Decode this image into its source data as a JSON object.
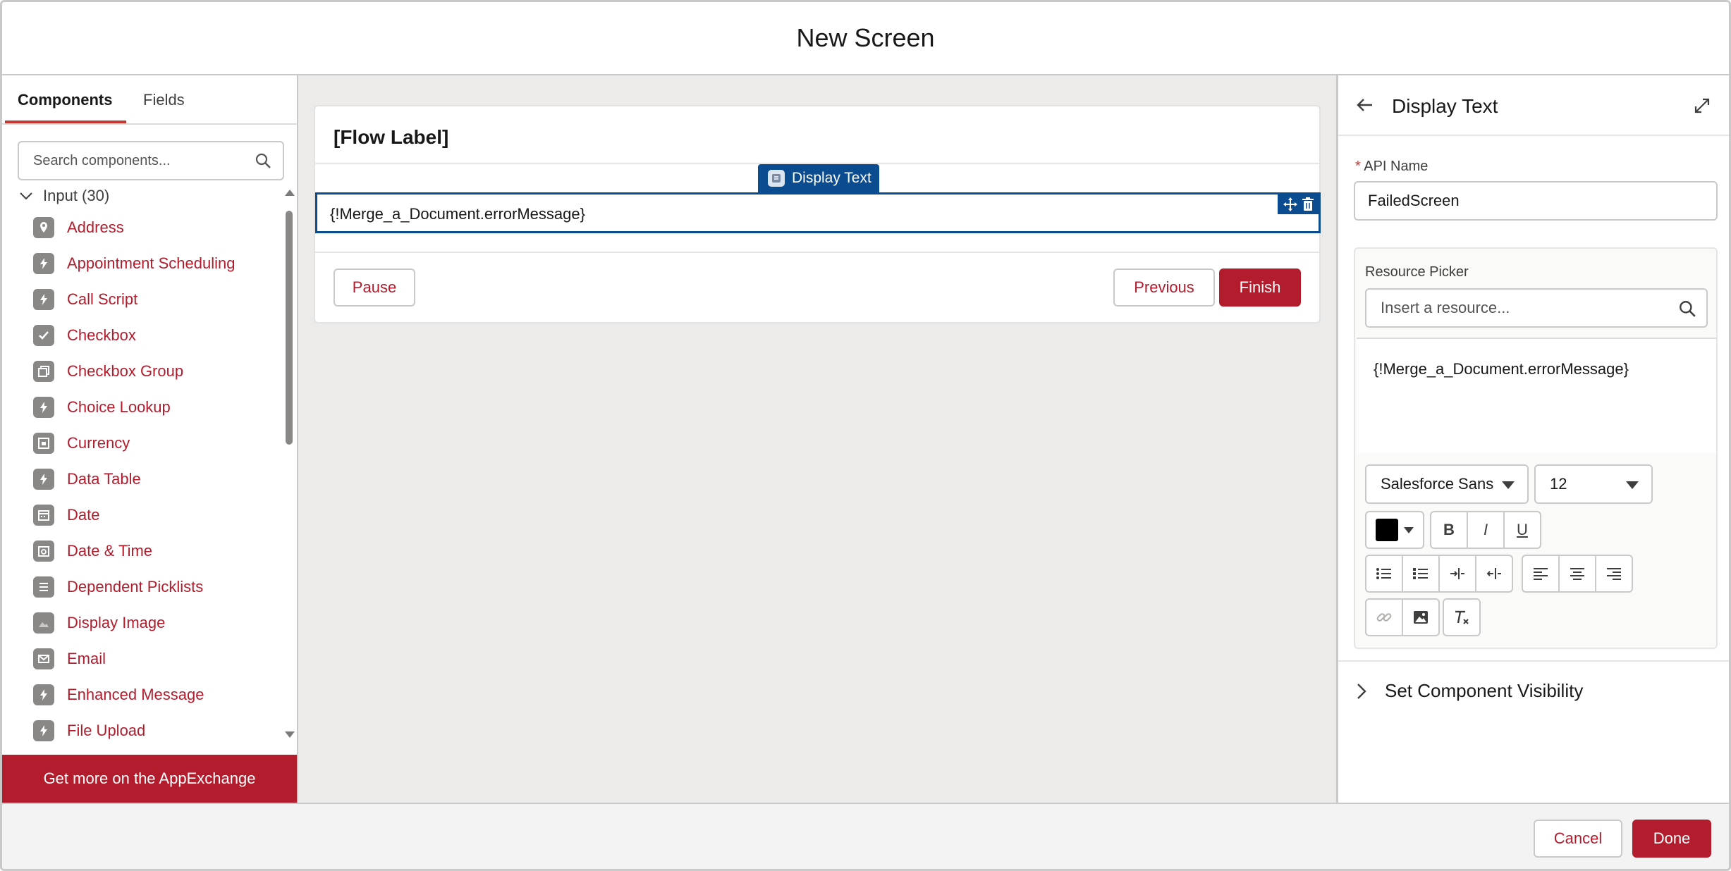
{
  "header": {
    "title": "New Screen"
  },
  "left_panel": {
    "tabs": [
      {
        "label": "Components",
        "active": true
      },
      {
        "label": "Fields",
        "active": false
      }
    ],
    "search": {
      "placeholder": "Search components..."
    },
    "section": {
      "label": "Input (30)",
      "expanded": true
    },
    "components": [
      {
        "label": "Address",
        "icon": "location-pin-icon"
      },
      {
        "label": "Appointment Scheduling",
        "icon": "lightning-icon"
      },
      {
        "label": "Call Script",
        "icon": "lightning-icon"
      },
      {
        "label": "Checkbox",
        "icon": "checkbox-icon"
      },
      {
        "label": "Checkbox Group",
        "icon": "checkbox-group-icon"
      },
      {
        "label": "Choice Lookup",
        "icon": "lightning-icon"
      },
      {
        "label": "Currency",
        "icon": "currency-icon"
      },
      {
        "label": "Data Table",
        "icon": "lightning-icon"
      },
      {
        "label": "Date",
        "icon": "calendar-icon"
      },
      {
        "label": "Date & Time",
        "icon": "calendar-clock-icon"
      },
      {
        "label": "Dependent Picklists",
        "icon": "list-icon"
      },
      {
        "label": "Display Image",
        "icon": "image-icon"
      },
      {
        "label": "Email",
        "icon": "email-icon"
      },
      {
        "label": "Enhanced Message",
        "icon": "lightning-icon"
      },
      {
        "label": "File Upload",
        "icon": "lightning-icon"
      }
    ],
    "appexchange": "Get more on the AppExchange"
  },
  "canvas": {
    "flow_label": "[Flow Label]",
    "selected_component_badge": "Display Text",
    "display_text_value": "{!Merge_a_Document.errorMessage}",
    "buttons": {
      "pause": "Pause",
      "previous": "Previous",
      "finish": "Finish"
    }
  },
  "right_panel": {
    "title": "Display Text",
    "api_name": {
      "required_mark": "*",
      "label": "API Name",
      "value": "FailedScreen"
    },
    "resource_picker": {
      "label": "Resource Picker",
      "placeholder": "Insert a resource..."
    },
    "editor_content": "{!Merge_a_Document.errorMessage}",
    "font_family": "Salesforce Sans",
    "font_size": "12",
    "text_color": "#000000",
    "format_buttons": [
      "B",
      "I",
      "U"
    ],
    "visibility": "Set Component Visibility"
  },
  "footer": {
    "cancel": "Cancel",
    "done": "Done"
  },
  "colors": {
    "brand": "#b21c2c",
    "selection": "#0b4b8f"
  }
}
